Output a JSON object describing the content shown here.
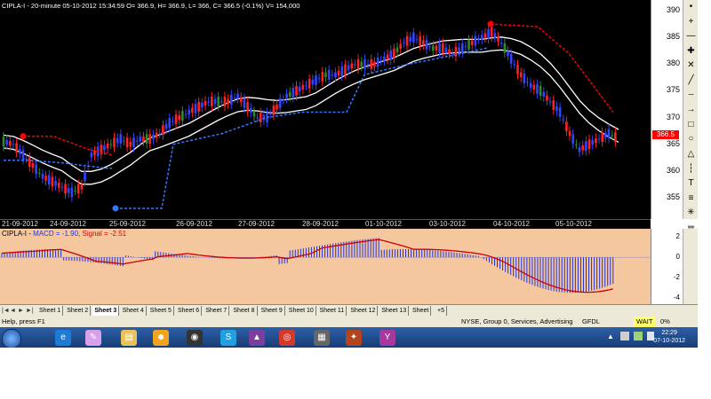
{
  "window": {
    "title": "CIPLA-I - 20-minute 05-10-2012 15:34:59 O= 366.9, H= 366.9, L= 366, C= 366.5 (-0.1%) V= 154,000"
  },
  "chart_data": [
    {
      "type": "candlestick",
      "title": "CIPLA-I - 20-minute 05-10-2012 15:34:59 O= 366.9, H= 366.9, L= 366, C= 366.5 (-0.1%) V= 154,000",
      "x_tick_labels": [
        "21-09-2012",
        "24-09-2012",
        "25-09-2012",
        "26-09-2012",
        "27-09-2012",
        "28-09-2012",
        "01-10-2012",
        "03-10-2012",
        "04-10-2012",
        "05-10-2012"
      ],
      "y_ticks": [
        355,
        360,
        365,
        370,
        375,
        380,
        385,
        390
      ],
      "ylim": [
        351,
        392
      ],
      "last_price_label": "366.5",
      "colors": {
        "up": "#3344ff",
        "down": "#ff2222",
        "neutral": "#2b8c2b",
        "bands": "#ffffff",
        "stop_up": "#3377ff",
        "stop_down": "#ff0000"
      },
      "close": [
        365.5,
        365,
        363,
        361,
        359,
        358,
        357,
        356,
        357,
        363,
        364,
        365,
        366,
        365,
        366,
        366,
        367,
        369,
        370,
        371,
        372,
        373,
        373,
        373,
        374,
        372,
        370,
        370,
        372,
        374,
        375,
        376,
        377,
        378,
        378,
        379,
        380,
        380,
        380,
        381,
        382,
        384,
        385,
        384,
        383,
        383,
        382,
        383,
        384,
        385,
        386,
        384,
        381,
        378,
        376,
        375,
        373,
        371,
        367,
        364,
        365,
        366,
        367,
        366
      ]
    },
    {
      "type": "macd",
      "title": "CIPLA-I - MACD = -1.90, Signal = -2.51",
      "y_ticks": [
        -4,
        -2,
        0,
        2
      ],
      "ylim": [
        -4.6,
        2.8
      ],
      "colors": {
        "histogram": "#2233dd",
        "signal": "#cc0000"
      },
      "macd_value": -1.9,
      "signal_value": -2.51
    }
  ],
  "macd_title": {
    "prefix": "CIPLA-I - ",
    "macd": "MACD = -1.90,",
    "signal": "Signal = -2.51"
  },
  "toolbar_icons": [
    "dot-icon",
    "plus-icon",
    "minus-icon",
    "cross-icon",
    "x-icon",
    "slash-icon",
    "dash-icon",
    "arrow-icon",
    "square-icon",
    "ellipse-icon",
    "triangle-icon",
    "line-icon",
    "t-icon",
    "fibonacci-icon",
    "gann-icon",
    "channel-icon",
    "pitchfork-icon",
    "cycle-icon",
    "rotate-green-icon",
    "refresh-green-icon",
    "arrow-green-icon",
    "undo-icon"
  ],
  "sheet_nav": {
    "arrows": [
      "|◄",
      "◄",
      "►",
      "►|"
    ]
  },
  "sheets": [
    "Sheet 1",
    "Sheet 2",
    "Sheet 3",
    "Sheet 4",
    "Sheet 5",
    "Sheet 6",
    "Sheet 7",
    "Sheet 8",
    "Sheet 9",
    "Sheet 10",
    "Sheet 11",
    "Sheet 12",
    "Sheet 13",
    "Sheet"
  ],
  "active_sheet": "Sheet 3",
  "sheet_extra": "+5",
  "status": {
    "help": "Help, press F1",
    "exchange": "NYSE, Group 0, Services, Advertising",
    "symbol": "GFDL",
    "wait": "WAIT",
    "percent": "0%"
  },
  "taskbar": {
    "apps": [
      "ie-icon",
      "paint-icon",
      "folder-icon",
      "messenger-icon",
      "media-icon",
      "skype-icon",
      "amibroker-icon",
      "chrome-icon",
      "calculator-icon",
      "game-icon",
      "yahoo-icon"
    ],
    "time": "22:29",
    "date": "07-10-2012"
  }
}
